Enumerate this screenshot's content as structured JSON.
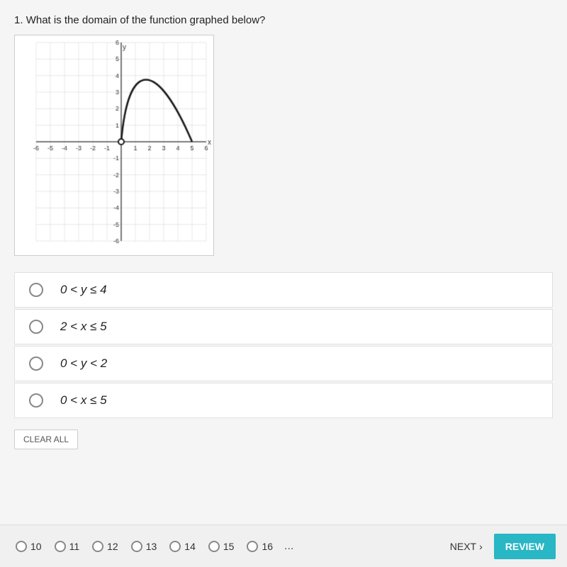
{
  "question": {
    "number": "1",
    "text": "What is the domain of the function graphed below?"
  },
  "options": [
    {
      "id": "A",
      "label": "0 < y ≤ 4",
      "selected": false
    },
    {
      "id": "B",
      "label": "2 < x ≤ 5",
      "selected": false
    },
    {
      "id": "C",
      "label": "0 < y < 2",
      "selected": false
    },
    {
      "id": "D",
      "label": "0 < x ≤ 5",
      "selected": false
    }
  ],
  "buttons": {
    "clear_all": "CLEAR ALL",
    "next": "NEXT",
    "review": "REVIEW"
  },
  "nav": {
    "pages": [
      "10",
      "11",
      "12",
      "13",
      "14",
      "15",
      "16"
    ],
    "dots": "..."
  }
}
